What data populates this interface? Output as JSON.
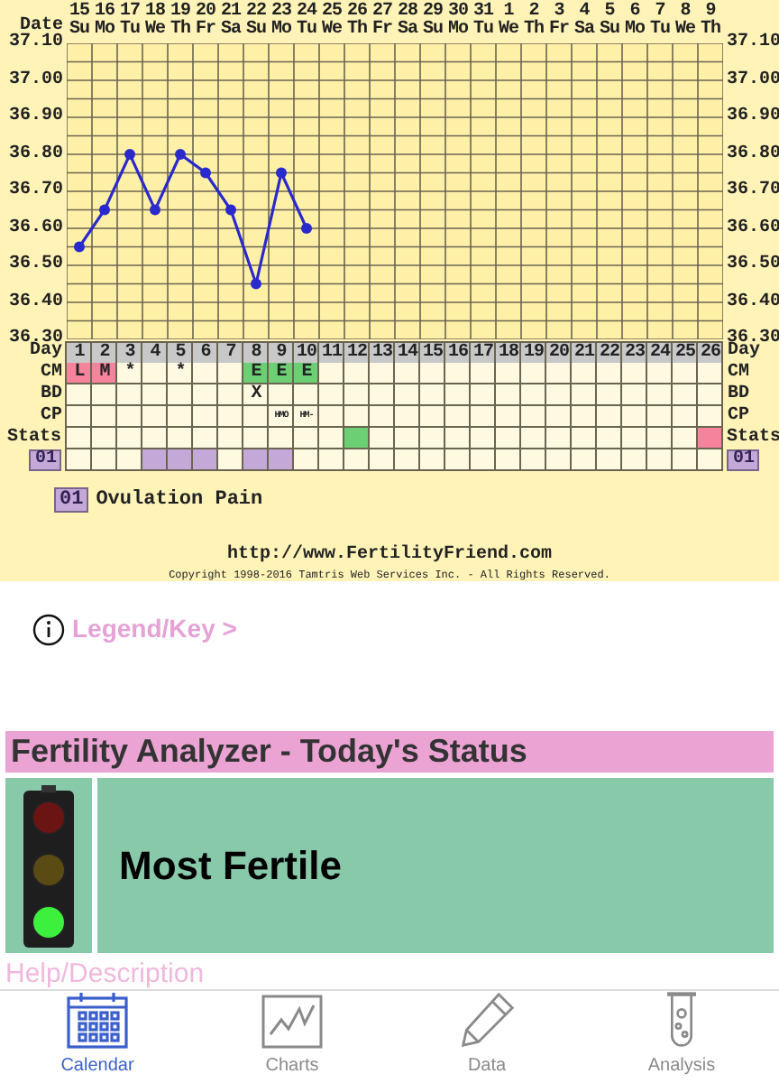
{
  "chart": {
    "date_label": "Date",
    "weekdays": [
      "Su",
      "Mo",
      "Tu",
      "We",
      "Th",
      "Fr",
      "Sa",
      "Su",
      "Mo",
      "Tu",
      "We",
      "Th",
      "Fr",
      "Sa",
      "Su",
      "Mo",
      "Tu",
      "We",
      "Th",
      "Fr",
      "Sa",
      "Su",
      "Mo",
      "Tu",
      "We",
      "Th"
    ],
    "right_axis_labels": [
      "37.10",
      "37.00",
      "36.90",
      "36.80",
      "36.70",
      "36.60",
      "36.50",
      "36.40",
      "36.30"
    ],
    "chart_data": {
      "type": "line",
      "categories": [
        "15",
        "16",
        "17",
        "18",
        "19",
        "20",
        "21",
        "22",
        "23",
        "24",
        "25",
        "26",
        "27",
        "28",
        "29",
        "30",
        "31",
        "1",
        "2",
        "3",
        "4",
        "5",
        "6",
        "7",
        "8",
        "9"
      ],
      "grid": true,
      "series": [
        {
          "color": "#2a2acc",
          "marker": "circle",
          "values": [
            36.55,
            36.65,
            36.8,
            36.65,
            36.8,
            36.75,
            36.65,
            36.45,
            36.75,
            36.6,
            null,
            null,
            null,
            null,
            null,
            null,
            null,
            null,
            null,
            null,
            null,
            null,
            null,
            null,
            null,
            null
          ]
        }
      ],
      "ylim": [
        36.3,
        37.1
      ],
      "yticks": [
        {
          "value": 37.1,
          "label": "37.10"
        },
        {
          "value": 37.0,
          "label": "37.00"
        },
        {
          "value": 36.9,
          "label": "36.90"
        },
        {
          "value": 36.8,
          "label": "36.80"
        },
        {
          "value": 36.7,
          "label": "36.70"
        },
        {
          "value": 36.6,
          "label": "36.60"
        },
        {
          "value": 36.5,
          "label": "36.50"
        },
        {
          "value": 36.4,
          "label": "36.40"
        },
        {
          "value": 36.3,
          "label": "36.30"
        }
      ]
    },
    "rows": [
      {
        "kind": "day",
        "label": "Day",
        "right_label": "Day",
        "cells": [
          {
            "text": "1"
          },
          {
            "text": "2"
          },
          {
            "text": "3"
          },
          {
            "text": "4"
          },
          {
            "text": "5"
          },
          {
            "text": "6"
          },
          {
            "text": "7"
          },
          {
            "text": "8"
          },
          {
            "text": "9"
          },
          {
            "text": "10"
          },
          {
            "text": "11"
          },
          {
            "text": "12"
          },
          {
            "text": "13"
          },
          {
            "text": "14"
          },
          {
            "text": "15"
          },
          {
            "text": "16"
          },
          {
            "text": "17"
          },
          {
            "text": "18"
          },
          {
            "text": "19"
          },
          {
            "text": "20"
          },
          {
            "text": "21"
          },
          {
            "text": "22"
          },
          {
            "text": "23"
          },
          {
            "text": "24"
          },
          {
            "text": "25"
          },
          {
            "text": "26"
          }
        ]
      },
      {
        "kind": "data",
        "label": "CM",
        "right_label": "CM",
        "cells": [
          {
            "text": "L",
            "color": "#f4839b"
          },
          {
            "text": "M",
            "color": "#f4839b"
          },
          {
            "text": "*"
          },
          {},
          {
            "text": "*"
          },
          {},
          {},
          {
            "text": "E",
            "color": "#6ccf74"
          },
          {
            "text": "E",
            "color": "#6ccf74"
          },
          {
            "text": "E",
            "color": "#6ccf74"
          },
          {},
          {},
          {},
          {},
          {},
          {},
          {},
          {},
          {},
          {},
          {},
          {},
          {},
          {},
          {},
          {}
        ]
      },
      {
        "kind": "data",
        "label": "BD",
        "right_label": "BD",
        "cells": [
          {},
          {},
          {},
          {},
          {},
          {},
          {},
          {
            "text": "X"
          },
          {},
          {},
          {},
          {},
          {},
          {},
          {},
          {},
          {},
          {},
          {},
          {},
          {},
          {},
          {},
          {},
          {},
          {}
        ]
      },
      {
        "kind": "data",
        "label": "CP",
        "right_label": "CP",
        "cells": [
          {},
          {},
          {},
          {},
          {},
          {},
          {},
          {},
          {
            "text": "HMO"
          },
          {
            "text": "HM-"
          },
          {},
          {},
          {},
          {},
          {},
          {},
          {},
          {},
          {},
          {},
          {},
          {},
          {},
          {},
          {},
          {}
        ]
      },
      {
        "kind": "data",
        "label": "Stats",
        "right_label": "Stats",
        "cells": [
          {},
          {},
          {},
          {},
          {},
          {},
          {},
          {},
          {},
          {},
          {},
          {
            "color": "#6ccf74"
          },
          {},
          {},
          {},
          {},
          {},
          {},
          {},
          {},
          {},
          {},
          {},
          {},
          {},
          {
            "color": "#f4839b"
          }
        ]
      },
      {
        "kind": "badge",
        "label": "01",
        "right_label": "01",
        "cells": [
          {},
          {},
          {},
          {
            "color": "#c4a8d8"
          },
          {
            "color": "#c4a8d8"
          },
          {
            "color": "#c4a8d8"
          },
          {},
          {
            "color": "#c4a8d8"
          },
          {
            "color": "#c4a8d8"
          },
          {},
          {},
          {},
          {},
          {},
          {},
          {},
          {},
          {},
          {},
          {},
          {},
          {},
          {},
          {},
          {},
          {}
        ]
      }
    ],
    "legend": [
      {
        "code": "01",
        "label": "Ovulation Pain"
      }
    ],
    "url": "http://www.FertilityFriend.com",
    "copyright": "Copyright 1998-2016 Tamtris Web Services Inc. - All Rights Reserved."
  },
  "legend_link": "Legend/Key >",
  "analyzer": {
    "title": "Fertility Analyzer - Today's Status",
    "lights": [
      {
        "on": false
      },
      {
        "on": false
      },
      {
        "on": true
      }
    ],
    "status": "Most Fertile",
    "help": "Help/Description"
  },
  "tabs": [
    {
      "kind": "calendar",
      "label": "Calendar",
      "selected": true
    },
    {
      "kind": "charts",
      "label": "Charts",
      "selected": false
    },
    {
      "kind": "data",
      "label": "Data",
      "selected": false
    },
    {
      "kind": "analysis",
      "label": "Analysis",
      "selected": false
    }
  ]
}
